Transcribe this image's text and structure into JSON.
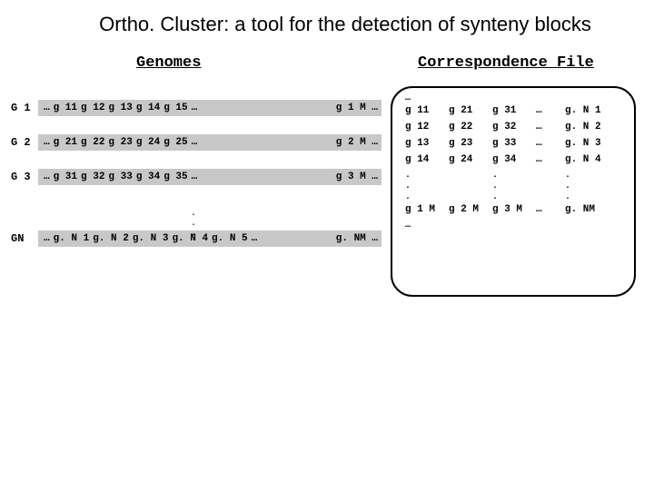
{
  "title": "Ortho. Cluster: a tool for the detection of synteny blocks",
  "headers": {
    "genomes": "Genomes",
    "corr": "Correspondence File"
  },
  "genomes": {
    "rows": [
      {
        "label": "G 1",
        "pre": "…",
        "cells": [
          "g 11",
          "g 12",
          "g 13",
          "g 14",
          "g 15",
          "…"
        ],
        "end": "g 1 M …"
      },
      {
        "label": "G 2",
        "pre": "…",
        "cells": [
          "g 21",
          "g 22",
          "g 23",
          "g 24",
          "g 25",
          "…"
        ],
        "end": "g 2 M …"
      },
      {
        "label": "G 3",
        "pre": "…",
        "cells": [
          "g 31",
          "g 32",
          "g 33",
          "g 34",
          "g 35",
          "…"
        ],
        "end": "g 3 M …"
      }
    ],
    "last": {
      "label": "GN",
      "pre": "…",
      "cells": [
        "g. N 1",
        "g. N 2",
        "g. N 3",
        "g. N 4",
        "g. N 5",
        "…"
      ],
      "end": "g. NM …"
    }
  },
  "vdots": ". \n. \n. ",
  "corr": {
    "pre": "…",
    "rows": [
      [
        "g 11",
        "g 21",
        "g 31",
        "…",
        "g. N 1"
      ],
      [
        "g 12",
        "g 22",
        "g 32",
        "…",
        "g. N 2"
      ],
      [
        "g 13",
        "g 23",
        "g 33",
        "…",
        "g. N 3"
      ],
      [
        "g 14",
        "g 24",
        "g 34",
        "…",
        "g. N 4"
      ]
    ],
    "dotrows": [
      [
        ".",
        "",
        "",
        "",
        ". ",
        " ",
        ". "
      ],
      [
        ".",
        "",
        "",
        "",
        ". ",
        " ",
        ". "
      ],
      [
        ".",
        "",
        "",
        "",
        ". ",
        " ",
        ". "
      ]
    ],
    "last": [
      "g 1 M",
      "g 2 M",
      "g 3 M",
      "…",
      "g. NM"
    ],
    "post": "…"
  }
}
